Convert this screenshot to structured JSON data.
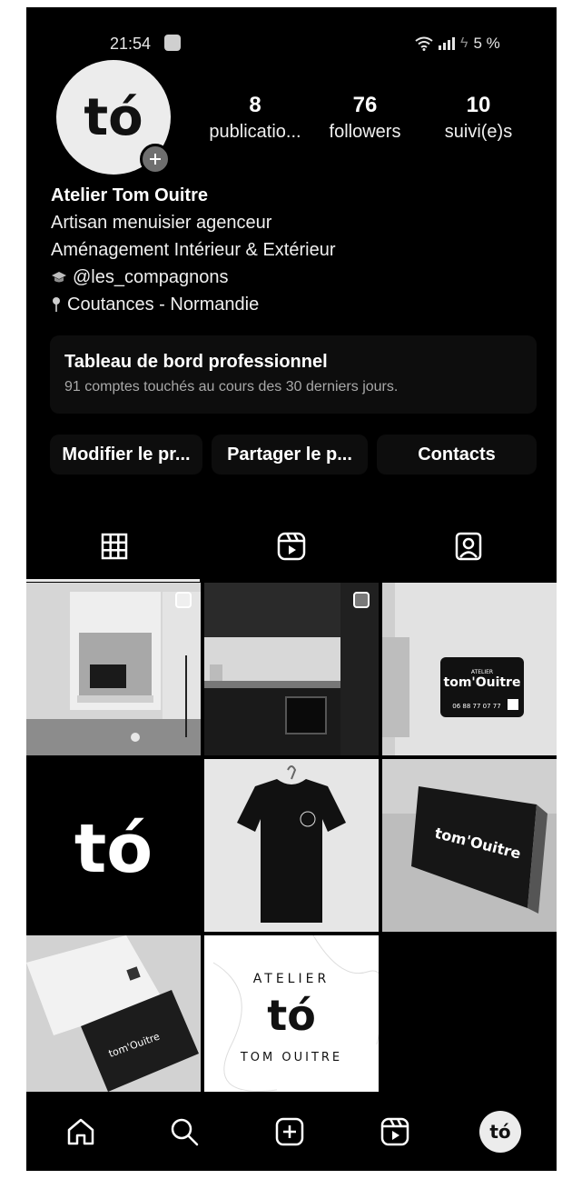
{
  "status_bar": {
    "time": "21:54",
    "battery": "5 %"
  },
  "profile": {
    "stats": [
      {
        "value": "8",
        "label": "publicatio..."
      },
      {
        "value": "76",
        "label": "followers"
      },
      {
        "value": "10",
        "label": "suivi(e)s"
      }
    ],
    "name": "Atelier Tom Ouitre",
    "bio_lines": [
      "Artisan menuisier agenceur",
      "Aménagement Intérieur & Extérieur",
      "@les_compagnons",
      "Coutances - Normandie"
    ],
    "dashboard": {
      "title": "Tableau de bord professionnel",
      "subtitle": "91 comptes touchés au cours des 30 derniers jours."
    },
    "buttons": [
      "Modifier le pr...",
      "Partager le p...",
      "Contacts"
    ]
  },
  "tabs": [
    {
      "icon": "grid-icon",
      "active": true
    },
    {
      "icon": "reels-icon",
      "active": false
    },
    {
      "icon": "tagged-icon",
      "active": false
    }
  ],
  "grid_tiles": [
    {
      "name": "tile-living-room",
      "multi": true
    },
    {
      "name": "tile-kitchen",
      "multi": true
    },
    {
      "name": "tile-van",
      "multi": false
    },
    {
      "name": "tile-logo-black",
      "multi": false
    },
    {
      "name": "tile-tshirt",
      "multi": false
    },
    {
      "name": "tile-sign",
      "multi": false
    },
    {
      "name": "tile-business-cards",
      "multi": false
    },
    {
      "name": "tile-stamp-logo",
      "multi": false
    }
  ],
  "artwork_text": {
    "logo": "tó",
    "van_sign": "tom'Ouitre",
    "van_sign_top": "ATELIER",
    "van_phone": "06 88 77 07 77",
    "sign_text": "tom'Ouitre",
    "card_text": "tom'Ouitre",
    "stamp_top": "ATELIER",
    "stamp_bottom": "TOM OUITRE"
  },
  "bottom_nav": [
    "home-icon",
    "search-icon",
    "create-icon",
    "reels-icon",
    "profile-avatar"
  ],
  "colors": {
    "background": "#000000",
    "text": "#ffffff",
    "muted": "#a8a8a8",
    "card": "#0d0d0d"
  }
}
